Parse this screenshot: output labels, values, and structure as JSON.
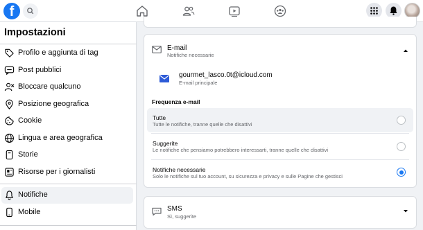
{
  "topbar": {
    "logo_letter": "f",
    "icons": [
      "facebook-logo",
      "search-icon",
      "home-icon",
      "friends-icon",
      "watch-icon",
      "groups-icon",
      "menu-grid-icon",
      "notifications-bell-icon",
      "profile-avatar"
    ]
  },
  "sidebar": {
    "title": "Impostazioni",
    "items": [
      {
        "label": "Profilo e aggiunta di tag",
        "icon": "tag-icon"
      },
      {
        "label": "Post pubblici",
        "icon": "public-post-icon"
      },
      {
        "label": "Bloccare qualcuno",
        "icon": "block-user-icon"
      },
      {
        "label": "Posizione geografica",
        "icon": "location-pin-icon"
      },
      {
        "label": "Cookie",
        "icon": "cookie-icon"
      },
      {
        "label": "Lingua e area geografica",
        "icon": "globe-icon"
      },
      {
        "label": "Storie",
        "icon": "stories-icon"
      },
      {
        "label": "Risorse per i giornalisti",
        "icon": "journalist-resources-icon"
      },
      {
        "label": "Notifiche",
        "icon": "bell-icon",
        "active": true
      },
      {
        "label": "Mobile",
        "icon": "mobile-icon"
      }
    ]
  },
  "email_section": {
    "title": "E-mail",
    "subtitle": "Notifiche necessarie",
    "address": "gourmet_lasco.0t@icloud.com",
    "address_label": "E-mail principale",
    "frequency_heading": "Frequenza e-mail",
    "options": [
      {
        "title": "Tutte",
        "desc": "Tutte le notifiche, tranne quelle che disattivi",
        "selected": false
      },
      {
        "title": "Suggerite",
        "desc": "Le notifiche che pensiamo potrebbero interessarti, tranne quelle che disattivi",
        "selected": false
      },
      {
        "title": "Notifiche necessarie",
        "desc": "Solo le notifiche sul tuo account, su sicurezza e privacy e sulle Pagine che gestisci",
        "selected": true
      }
    ]
  },
  "sms_section": {
    "title": "SMS",
    "subtitle": "Sì, suggerite"
  },
  "colors": {
    "accent": "#1877f2",
    "background": "#f0f2f5",
    "secondary_text": "#65676b"
  }
}
